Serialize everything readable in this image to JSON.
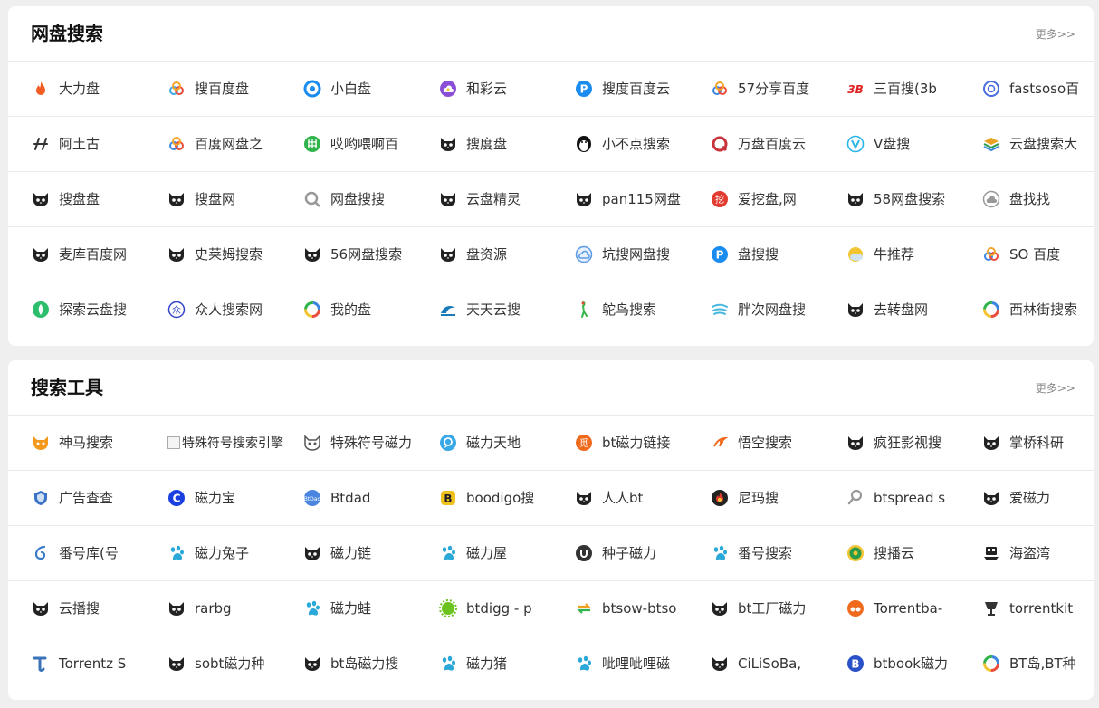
{
  "sections": [
    {
      "title": "网盘搜索",
      "more": "更多>>",
      "rows": [
        [
          {
            "label": "大力盘",
            "icon": "flame-icon",
            "color": "#f25b22"
          },
          {
            "label": "搜百度盘",
            "icon": "cloud-circles-icon",
            "color": "#38a8e6"
          },
          {
            "label": "小白盘",
            "icon": "target-ring-icon",
            "color": "#1a8cf0"
          },
          {
            "label": "和彩云",
            "icon": "cloud-purple-icon",
            "color": "#8a4fd6"
          },
          {
            "label": "搜度百度云",
            "icon": "p-circle-icon",
            "color": "#1a8cf0"
          },
          {
            "label": "57分享百度",
            "icon": "cloud-circles-icon",
            "color": "#3b87e0"
          },
          {
            "label": "三百搜(3b",
            "icon": "3b-logo-icon",
            "color": "#d22"
          },
          {
            "label": "fastsoso百",
            "icon": "q-circle-icon",
            "color": "#4a6de0"
          }
        ],
        [
          {
            "label": "阿土古",
            "icon": "h-mark-icon",
            "color": "#333"
          },
          {
            "label": "百度网盘之",
            "icon": "cloud-circles-icon",
            "color": "#3b87e0"
          },
          {
            "label": "哎哟喂啊百",
            "icon": "green-badge-icon",
            "color": "#2fb34a"
          },
          {
            "label": "搜度盘",
            "icon": "cat-icon",
            "color": "#222"
          },
          {
            "label": "小不点搜索",
            "icon": "penguin-icon",
            "color": "#111"
          },
          {
            "label": "万盘百度云",
            "icon": "q-ring-icon",
            "color": "#c8333b"
          },
          {
            "label": "V盘搜",
            "icon": "v-circle-icon",
            "color": "#2bb5e8"
          },
          {
            "label": "云盘搜索大",
            "icon": "layers-icon",
            "color": "#e9a323"
          }
        ],
        [
          {
            "label": "搜盘盘",
            "icon": "cat-icon",
            "color": "#222"
          },
          {
            "label": "搜盘网",
            "icon": "cat-icon",
            "color": "#222"
          },
          {
            "label": "网盘搜搜",
            "icon": "magnifier-q-icon",
            "color": "#999"
          },
          {
            "label": "云盘精灵",
            "icon": "cat-icon",
            "color": "#222"
          },
          {
            "label": "pan115网盘",
            "icon": "cat-icon",
            "color": "#222"
          },
          {
            "label": "爱挖盘,网",
            "icon": "dig-icon",
            "color": "#e23b2f"
          },
          {
            "label": "58网盘搜索",
            "icon": "cat-icon",
            "color": "#222"
          },
          {
            "label": "盘找找",
            "icon": "cloud-gray-icon",
            "color": "#999"
          }
        ],
        [
          {
            "label": "麦库百度网",
            "icon": "cat-icon",
            "color": "#222"
          },
          {
            "label": "史莱姆搜索",
            "icon": "cat-icon",
            "color": "#222"
          },
          {
            "label": "56网盘搜索",
            "icon": "cat-icon",
            "color": "#222"
          },
          {
            "label": "盘资源",
            "icon": "cat-icon",
            "color": "#222"
          },
          {
            "label": "坑搜网盘搜",
            "icon": "cloud-blue-icon",
            "color": "#5a9ae6"
          },
          {
            "label": "盘搜搜",
            "icon": "p-circle-icon",
            "color": "#1a8cf0"
          },
          {
            "label": "牛推荐",
            "icon": "sun-icon",
            "color": "#f3c533"
          },
          {
            "label": "SO 百度",
            "icon": "cloud-circles-icon",
            "color": "#3b87e0"
          }
        ],
        [
          {
            "label": "探索云盘搜",
            "icon": "leaf-circle-icon",
            "color": "#2cbe6c"
          },
          {
            "label": "众人搜索网",
            "icon": "people-circle-icon",
            "color": "#3344c8"
          },
          {
            "label": "我的盘",
            "icon": "rainbow-ring-icon",
            "color": "#e94b3c"
          },
          {
            "label": "天天云搜",
            "icon": "wave-icon",
            "color": "#1a7bb8"
          },
          {
            "label": "鸵鸟搜索",
            "icon": "ostrich-icon",
            "color": "#3ab54a"
          },
          {
            "label": "胖次网盘搜",
            "icon": "stripes-icon",
            "color": "#49b8e0"
          },
          {
            "label": "去转盘网",
            "icon": "cat-icon",
            "color": "#222"
          },
          {
            "label": "西林街搜索",
            "icon": "rainbow-ring-icon",
            "color": "#e94b3c"
          }
        ]
      ]
    },
    {
      "title": "搜索工具",
      "more": "更多>>",
      "rows": [
        [
          {
            "label": "神马搜索",
            "icon": "fox-icon",
            "color": "#f39a1e"
          },
          {
            "label": "特殊符号搜索引擎",
            "icon": "broken-image-icon",
            "color": "#999",
            "broken": true
          },
          {
            "label": "特殊符号磁力",
            "icon": "cat-outline-icon",
            "color": "#555",
            "overlap": "特殊符号搜"
          },
          {
            "label": "磁力天地",
            "icon": "chat-circle-icon",
            "color": "#38a8e6"
          },
          {
            "label": "bt磁力链接",
            "icon": "avatar-orange-icon",
            "color": "#f06a1e"
          },
          {
            "label": "悟空搜索",
            "icon": "monkey-icon",
            "color": "#f06a1e"
          },
          {
            "label": "疯狂影视搜",
            "icon": "cat-icon",
            "color": "#222"
          },
          {
            "label": "掌桥科研",
            "icon": "cat-icon",
            "color": "#222"
          }
        ],
        [
          {
            "label": "广告查查",
            "icon": "shield-icon",
            "color": "#3a73c8"
          },
          {
            "label": "磁力宝",
            "icon": "c-circle-icon",
            "color": "#1a3fe0"
          },
          {
            "label": "Btdad",
            "icon": "btdad-icon",
            "color": "#4a86e0"
          },
          {
            "label": "boodigo搜",
            "icon": "b-square-icon",
            "color": "#f0c21e"
          },
          {
            "label": "人人bt",
            "icon": "cat-icon",
            "color": "#222"
          },
          {
            "label": "尼玛搜",
            "icon": "flame-dark-icon",
            "color": "#e23b2f"
          },
          {
            "label": "btspread s",
            "icon": "search-gray-icon",
            "color": "#999"
          },
          {
            "label": "爱磁力",
            "icon": "cat-icon",
            "color": "#222"
          }
        ],
        [
          {
            "label": "番号库(号",
            "icon": "swirl-icon",
            "color": "#3a7bc8"
          },
          {
            "label": "磁力兔子",
            "icon": "paw-icon",
            "color": "#2aa8d8"
          },
          {
            "label": "磁力链",
            "icon": "cat-icon",
            "color": "#222"
          },
          {
            "label": "磁力屋",
            "icon": "paw-icon",
            "color": "#2aa8d8"
          },
          {
            "label": "种子磁力",
            "icon": "u-circle-icon",
            "color": "#333"
          },
          {
            "label": "番号搜索",
            "icon": "paw-icon",
            "color": "#2aa8d8"
          },
          {
            "label": "搜播云",
            "icon": "badge-green-icon",
            "color": "#2a9b4a"
          },
          {
            "label": "海盗湾",
            "icon": "ship-icon",
            "color": "#222"
          }
        ],
        [
          {
            "label": "云播搜",
            "icon": "cat-icon",
            "color": "#222"
          },
          {
            "label": "rarbg",
            "icon": "cat-icon",
            "color": "#222"
          },
          {
            "label": "磁力蛙",
            "icon": "paw-icon",
            "color": "#2aa8d8"
          },
          {
            "label": "btdigg - p",
            "icon": "gear-green-icon",
            "color": "#6cc21e"
          },
          {
            "label": "btsow-btso",
            "icon": "swap-arrows-icon",
            "color": "#f0a01e"
          },
          {
            "label": "bt工厂磁力",
            "icon": "cat-icon",
            "color": "#222"
          },
          {
            "label": "Torrentba-",
            "icon": "face-orange-icon",
            "color": "#f06a1e"
          },
          {
            "label": "torrentkit",
            "icon": "cup-icon",
            "color": "#333"
          }
        ],
        [
          {
            "label": "Torrentz S",
            "icon": "t-mark-icon",
            "color": "#3a73b8"
          },
          {
            "label": "sobt磁力种",
            "icon": "cat-icon",
            "color": "#222"
          },
          {
            "label": "bt岛磁力搜",
            "icon": "cat-icon",
            "color": "#222"
          },
          {
            "label": "磁力猪",
            "icon": "paw-icon",
            "color": "#2aa8d8"
          },
          {
            "label": "呲哩呲哩磁",
            "icon": "paw-icon",
            "color": "#2aa8d8"
          },
          {
            "label": "CiLiSoBa,",
            "icon": "cat-icon",
            "color": "#222"
          },
          {
            "label": "btbook磁力",
            "icon": "b-circle-icon",
            "color": "#2a52c8"
          },
          {
            "label": "BT岛,BT种",
            "icon": "rainbow-ring-icon",
            "color": "#e94b3c"
          }
        ]
      ]
    }
  ]
}
